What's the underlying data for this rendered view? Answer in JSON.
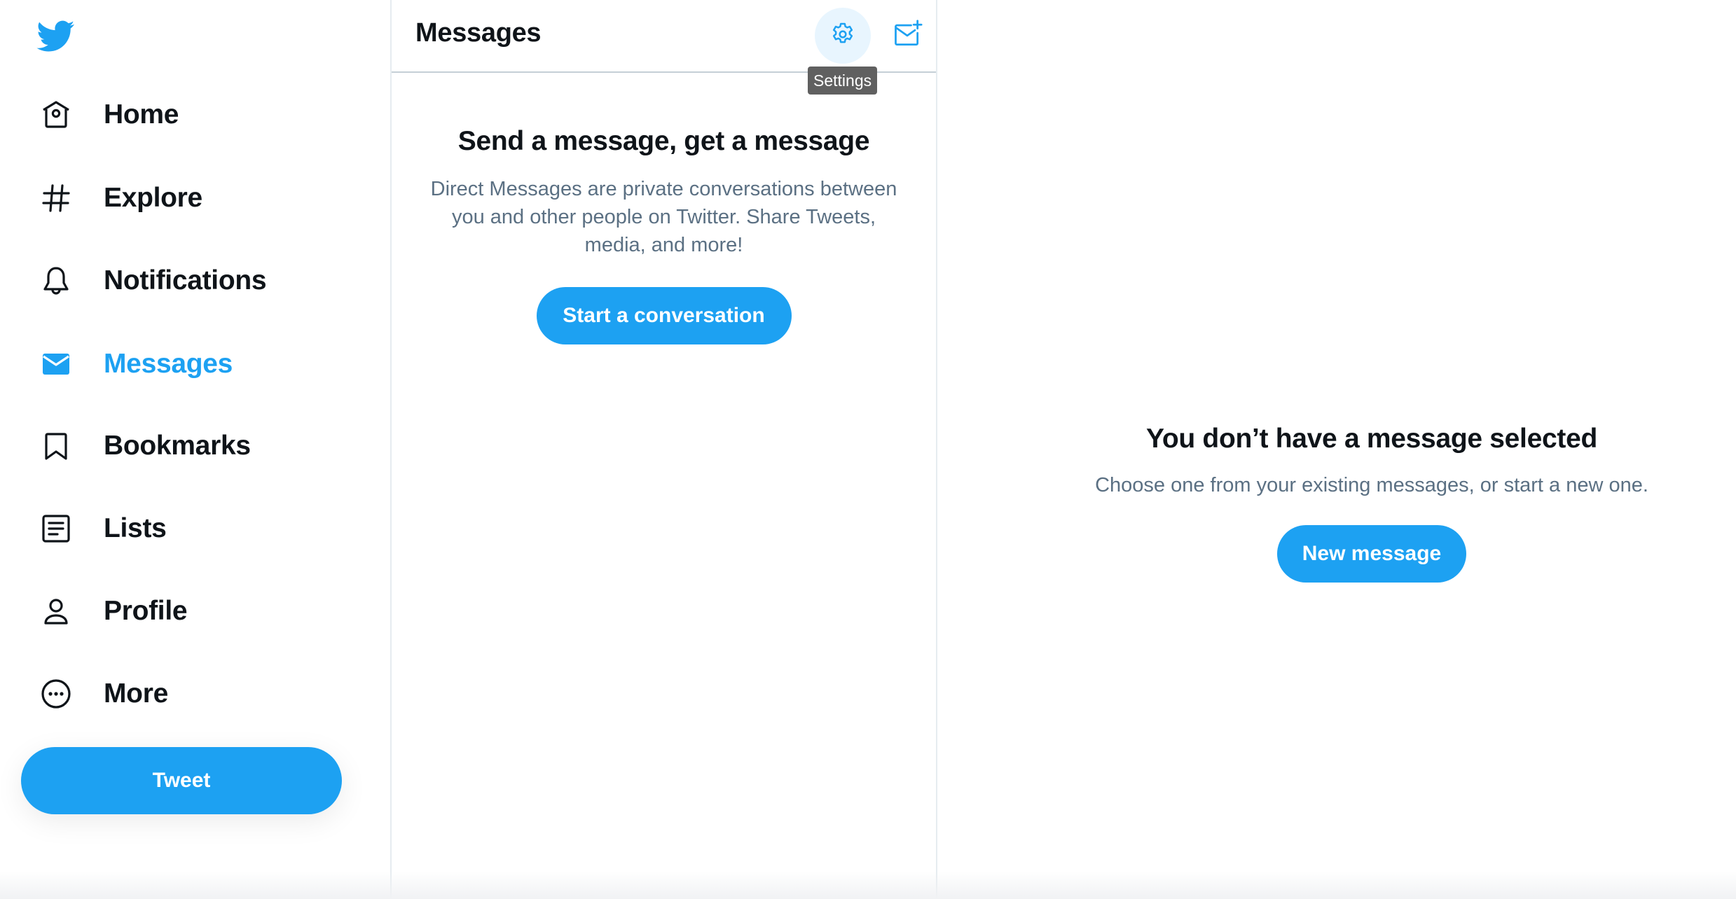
{
  "app": {
    "name": "Twitter",
    "brand_color": "#1DA1F2",
    "text_color": "#0F1419",
    "secondary_text_color": "#5B7083"
  },
  "sidebar": {
    "logo_icon": "twitter-bird-icon",
    "items": [
      {
        "label": "Home",
        "icon": "home-icon",
        "active": false
      },
      {
        "label": "Explore",
        "icon": "hashtag-icon",
        "active": false
      },
      {
        "label": "Notifications",
        "icon": "bell-icon",
        "active": false
      },
      {
        "label": "Messages",
        "icon": "envelope-icon",
        "active": true
      },
      {
        "label": "Bookmarks",
        "icon": "bookmark-icon",
        "active": false
      },
      {
        "label": "Lists",
        "icon": "list-icon",
        "active": false
      },
      {
        "label": "Profile",
        "icon": "person-icon",
        "active": false
      },
      {
        "label": "More",
        "icon": "more-circle-icon",
        "active": false
      }
    ],
    "tweet_label": "Tweet"
  },
  "messages_panel": {
    "title": "Messages",
    "settings_icon": "gear-icon",
    "compose_icon": "new-message-icon",
    "tooltip": "Settings",
    "empty_heading": "Send a message, get a message",
    "empty_text": "Direct Messages are private conversations between you and other people on Twitter. Share Tweets, media, and more!",
    "start_label": "Start a conversation"
  },
  "detail_panel": {
    "heading": "You don’t have a message selected",
    "text": "Choose one from your existing messages, or start a new one.",
    "new_message_label": "New message"
  }
}
